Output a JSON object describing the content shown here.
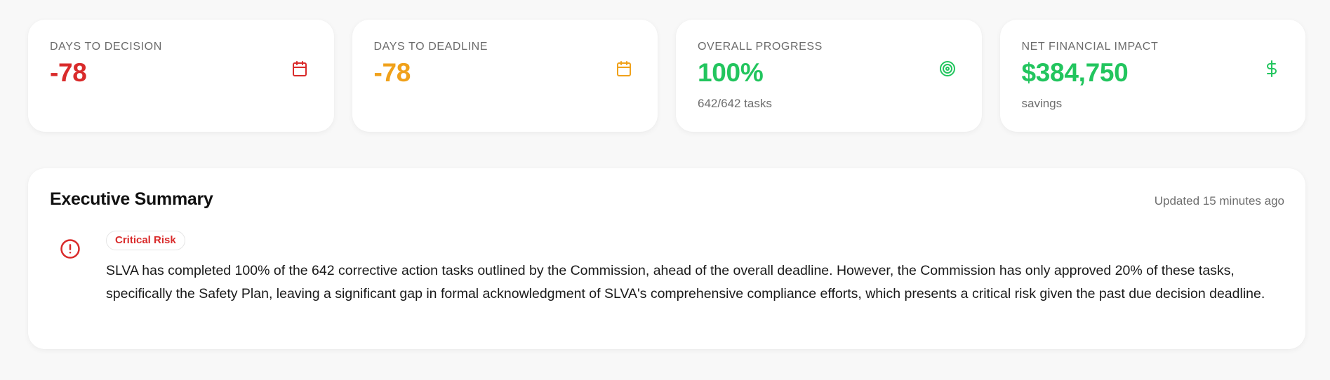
{
  "cards": [
    {
      "label": "Days to Decision",
      "value": "-78",
      "sub": "",
      "icon": "calendar-icon",
      "color": "#d92b2b"
    },
    {
      "label": "Days to Deadline",
      "value": "-78",
      "sub": "",
      "icon": "calendar-icon",
      "color": "#f0a11a"
    },
    {
      "label": "Overall Progress",
      "value": "100%",
      "sub": "642/642 tasks",
      "icon": "target-icon",
      "color": "#22c55e"
    },
    {
      "label": "Net Financial Impact",
      "value": "$384,750",
      "sub": "savings",
      "icon": "dollar-icon",
      "color": "#22c55e"
    }
  ],
  "summary": {
    "title": "Executive Summary",
    "updated": "Updated 15 minutes ago",
    "risk_label": "Critical Risk",
    "risk_icon": "alert-circle-icon",
    "risk_color": "#d92b2b",
    "text": "SLVA has completed 100% of the 642 corrective action tasks outlined by the Commission, ahead of the overall deadline. However, the Commission has only approved 20% of these tasks, specifically the Safety Plan, leaving a significant gap in formal acknowledgment of SLVA's comprehensive compliance efforts, which presents a critical risk given the past due decision deadline."
  }
}
